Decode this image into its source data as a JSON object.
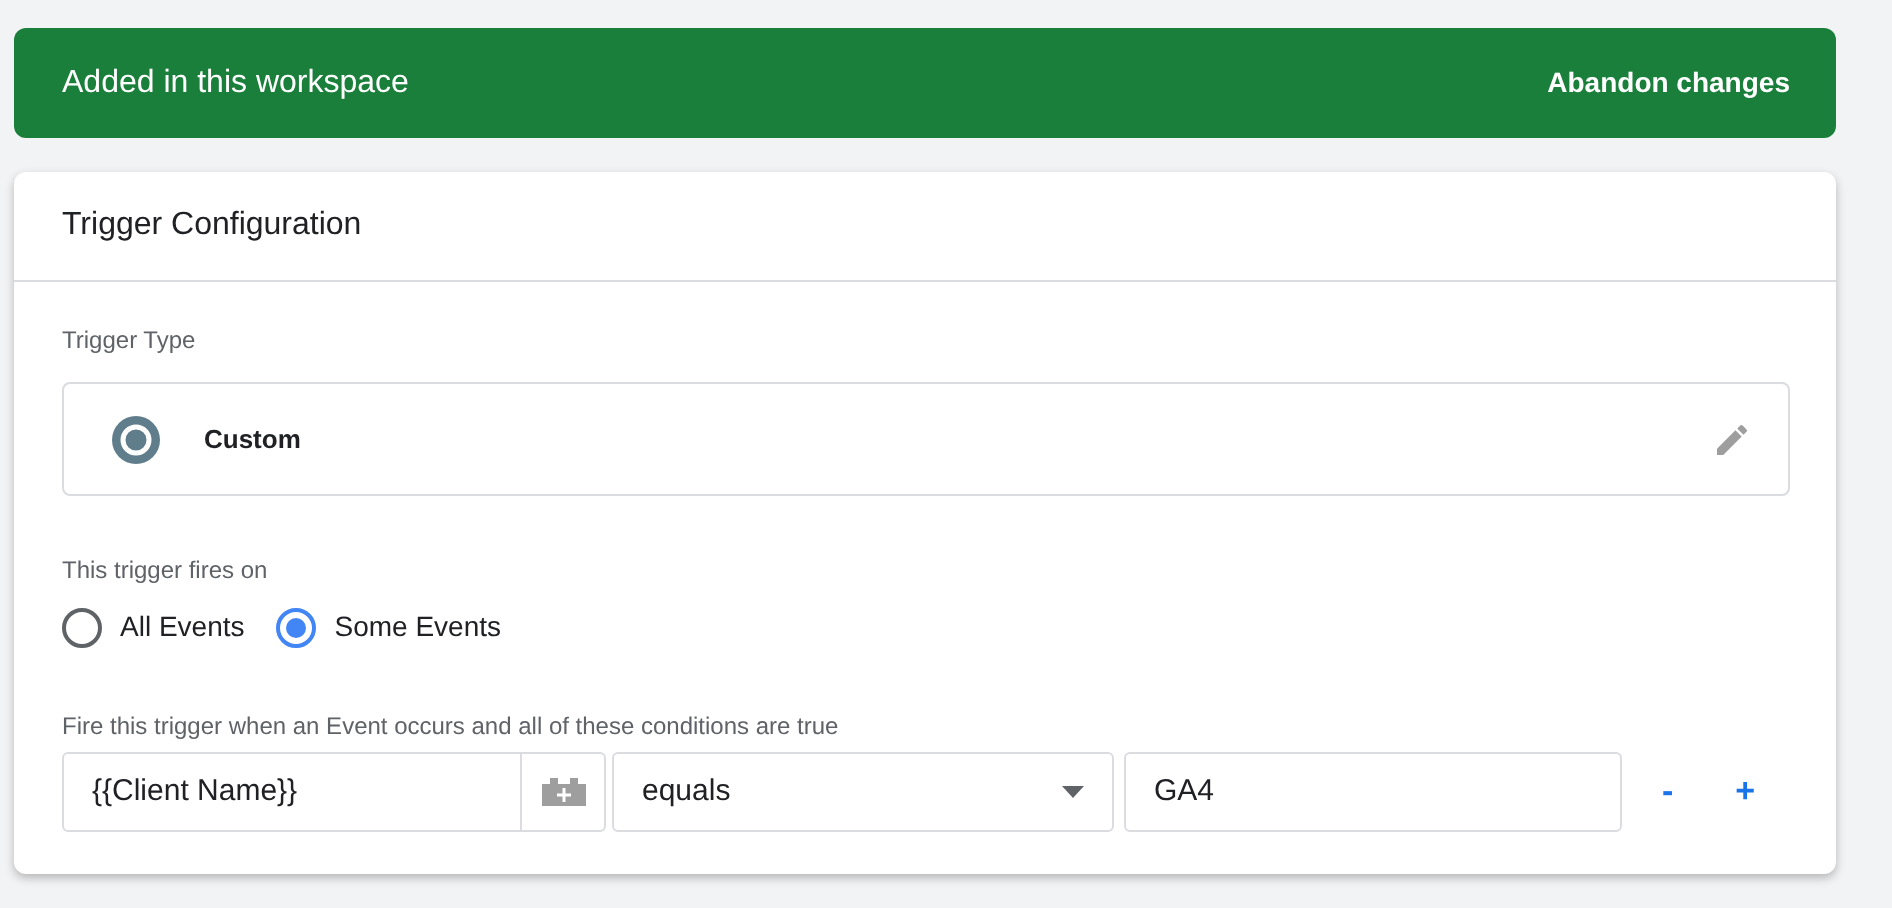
{
  "banner": {
    "title": "Added in this workspace",
    "action": "Abandon changes"
  },
  "card": {
    "title": "Trigger Configuration"
  },
  "trigger_type": {
    "label": "Trigger Type",
    "value": "Custom"
  },
  "fires_on": {
    "label": "This trigger fires on",
    "options": [
      {
        "label": "All Events",
        "selected": false
      },
      {
        "label": "Some Events",
        "selected": true
      }
    ]
  },
  "conditions": {
    "label": "Fire this trigger when an Event occurs and all of these conditions are true",
    "rows": [
      {
        "variable": "{{Client Name}}",
        "operator": "equals",
        "value": "GA4",
        "remove": "-",
        "add": "+"
      }
    ]
  }
}
